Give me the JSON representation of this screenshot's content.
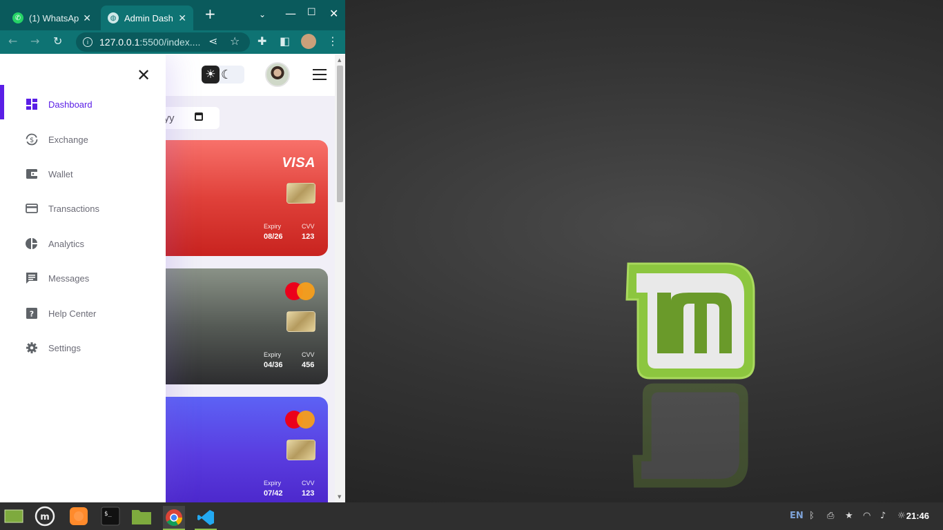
{
  "browser": {
    "tabs": [
      {
        "label": "(1) WhatsAp",
        "icon": "whatsapp-icon",
        "active": false
      },
      {
        "label": "Admin Dash",
        "icon": "globe-icon",
        "active": true
      }
    ],
    "url_host": "127.0.0.1",
    "url_rest": ":5500/index...."
  },
  "app": {
    "date_placeholder": "yyy",
    "nav": [
      {
        "label": "Dashboard",
        "icon": "dashboard-icon",
        "active": true
      },
      {
        "label": "Exchange",
        "icon": "exchange-icon"
      },
      {
        "label": "Wallet",
        "icon": "wallet-icon"
      },
      {
        "label": "Transactions",
        "icon": "credit-card-icon"
      },
      {
        "label": "Analytics",
        "icon": "pie-chart-icon"
      },
      {
        "label": "Messages",
        "icon": "message-icon"
      },
      {
        "label": "Help Center",
        "icon": "help-icon"
      },
      {
        "label": "Settings",
        "icon": "gear-icon"
      }
    ],
    "cards": [
      {
        "brand": "VISA",
        "expiry_label": "Expiry",
        "expiry": "08/26",
        "cvv_label": "CVV",
        "cvv": "123"
      },
      {
        "brand": "mastercard",
        "expiry_label": "Expiry",
        "expiry": "04/36",
        "cvv_label": "CVV",
        "cvv": "456"
      },
      {
        "brand": "mastercard",
        "expiry_label": "Expiry",
        "expiry": "07/42",
        "cvv_label": "CVV",
        "cvv": "123"
      }
    ]
  },
  "taskbar": {
    "language": "EN",
    "clock": "21:46"
  },
  "colors": {
    "accent": "#5a1ee6",
    "browser_frame": "#0e7373"
  }
}
